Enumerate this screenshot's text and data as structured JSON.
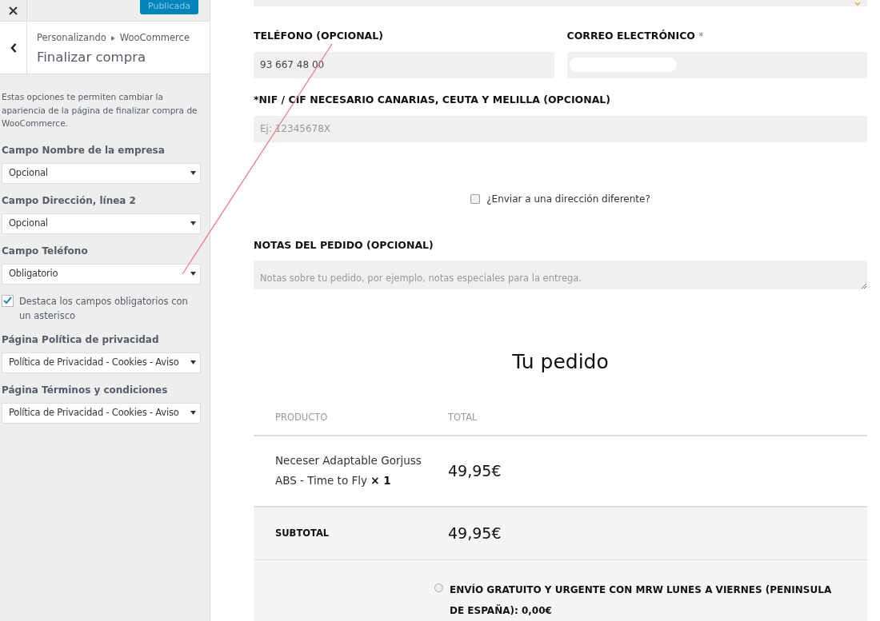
{
  "sidebar": {
    "publish_button": "Publicada",
    "breadcrumb": {
      "parent": "Personalizando",
      "current": "WooCommerce"
    },
    "title": "Finalizar compra",
    "description": "Estas opciones te permiten cambiar la apariencia de la página de finalizar compra de WooCommerce.",
    "controls": [
      {
        "kind": "select",
        "label": "Campo Nombre de la empresa",
        "value": "Opcional"
      },
      {
        "kind": "select",
        "label": "Campo Dirección, línea 2",
        "value": "Opcional"
      },
      {
        "kind": "select",
        "label": "Campo Teléfono",
        "value": "Obligatorio"
      },
      {
        "kind": "checkbox",
        "label": "Destaca los campos obligatorios con un asterisco",
        "checked": true
      },
      {
        "kind": "select",
        "label": "Página Política de privacidad",
        "value": "Política de Privacidad - Cookies - Aviso"
      },
      {
        "kind": "select",
        "label": "Página Términos y condiciones",
        "value": "Política de Privacidad - Cookies - Aviso"
      }
    ]
  },
  "checkout": {
    "phone": {
      "label": "TELÉFONO (OPCIONAL)",
      "value": "93 667 48 00"
    },
    "email": {
      "label": "CORREO ELECTRÓNICO",
      "required_mark": "*"
    },
    "nif": {
      "label": "*NIF / CIF NECESARIO CANARIAS, CEUTA Y MELILLA (OPCIONAL)",
      "placeholder": "Ej: 12345678X"
    },
    "ship_different": {
      "label": "¿Enviar a una dirección diferente?",
      "checked": false
    },
    "notes": {
      "label": "NOTAS DEL PEDIDO (OPCIONAL)",
      "placeholder": "Notas sobre tu pedido, por ejemplo, notas especiales para la entrega."
    },
    "order": {
      "title": "Tu pedido",
      "columns": [
        "PRODUCTO",
        "TOTAL"
      ],
      "items": [
        {
          "product": "Neceser Adaptable Gorjuss ABS - Time to Fly",
          "quantity": "× 1",
          "total": "49,95€"
        }
      ],
      "subtotal": {
        "label": "SUBTOTAL",
        "value": "49,95€"
      },
      "shipping_options": [
        {
          "label": "ENVÍO GRATUITO Y URGENTE CON MRW LUNES A VIERNES (PENINSULA DE ESPAÑA): **0,00€**",
          "selected": false
        }
      ]
    }
  }
}
